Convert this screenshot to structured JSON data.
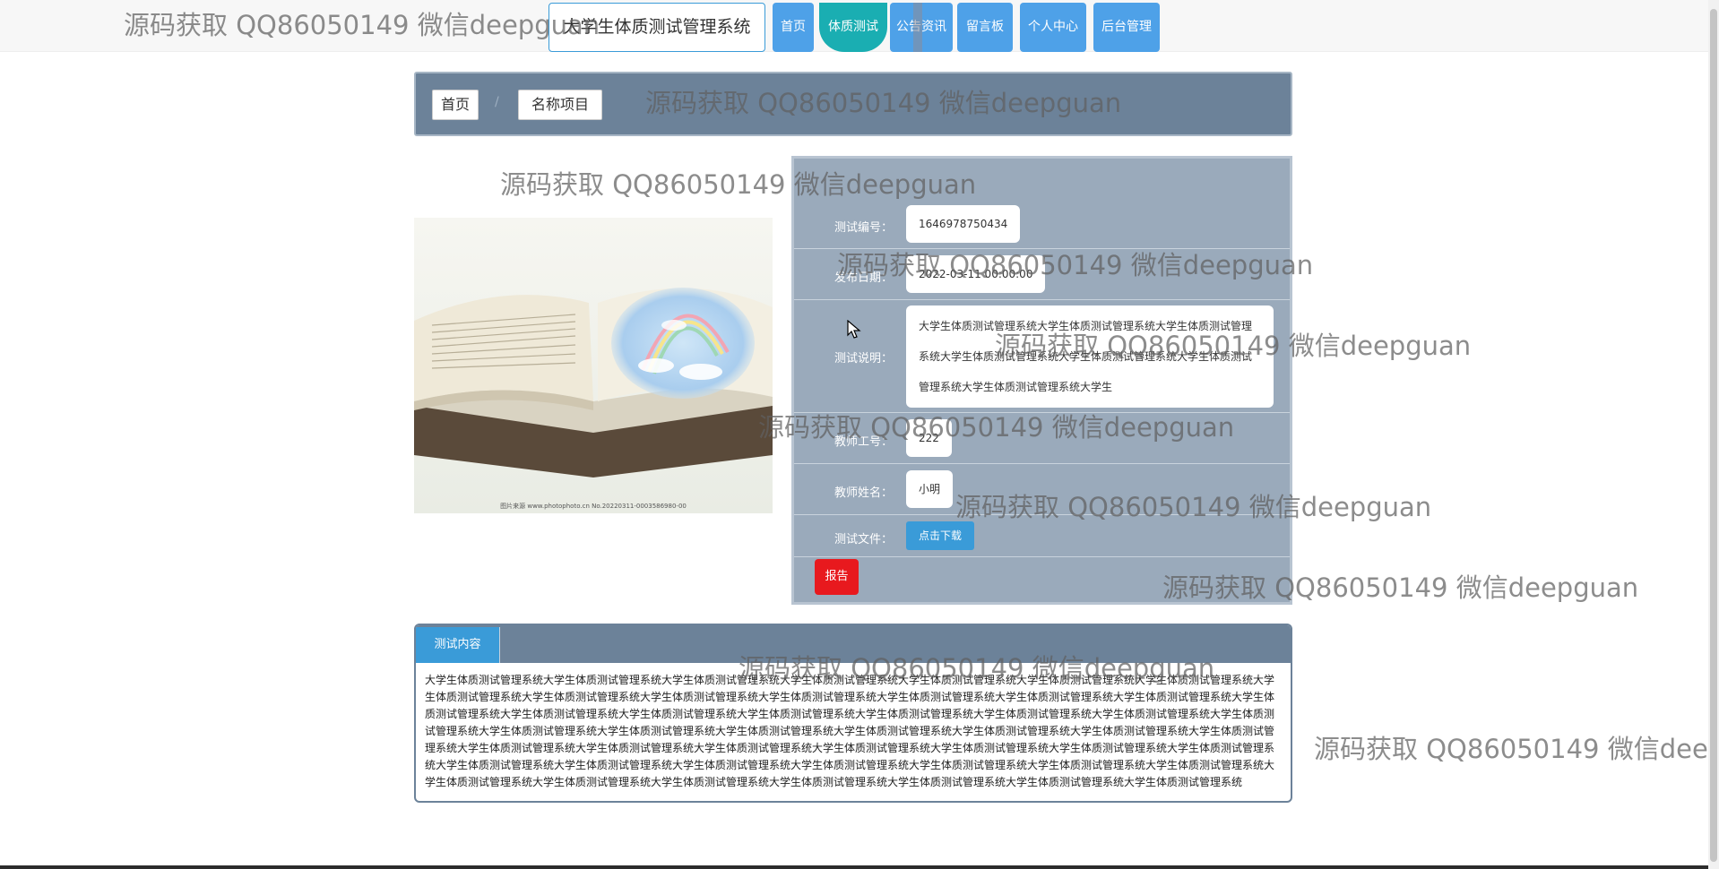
{
  "app": {
    "title": "大学生体质测试管理系统"
  },
  "nav": {
    "items": [
      {
        "label": "首页"
      },
      {
        "label": "体质测试"
      },
      {
        "label": "公告资讯"
      },
      {
        "label": "留言板"
      },
      {
        "label": "个人中心"
      },
      {
        "label": "后台管理"
      }
    ],
    "active": "体质测试"
  },
  "breadcrumb": {
    "home": "首页",
    "current": "名称项目"
  },
  "detail": {
    "test_id_label": "测试编号：",
    "test_id": "1646978750434",
    "publish_date_label": "发布日期：",
    "publish_date": "2022-03-11 00:00:00",
    "description_label": "测试说明：",
    "description": "大学生体质测试管理系统大学生体质测试管理系统大学生体质测试管理系统大学生体质测试管理系统大学生体质测试管理系统大学生体质测试管理系统大学生体质测试管理系统大学生",
    "teacher_id_label": "教师工号：",
    "teacher_id": "222",
    "teacher_name_label": "教师姓名：",
    "teacher_name": "小明",
    "file_label": "测试文件：",
    "download_button": "点击下载",
    "report_button": "报告"
  },
  "tab": {
    "label": "测试内容",
    "content": "大学生体质测试管理系统大学生体质测试管理系统大学生体质测试管理系统大学生体质测试管理系统大学生体质测试管理系统大学生体质测试管理系统大学生体质测试管理系统大学生体质测试管理系统大学生体质测试管理系统大学生体质测试管理系统大学生体质测试管理系统大学生体质测试管理系统大学生体质测试管理系统大学生体质测试管理系统大学生体质测试管理系统大学生体质测试管理系统大学生体质测试管理系统大学生体质测试管理系统大学生体质测试管理系统大学生体质测试管理系统大学生体质测试管理系统大学生体质测试管理系统大学生体质测试管理系统大学生体质测试管理系统大学生体质测试管理系统大学生体质测试管理系统大学生体质测试管理系统大学生体质测试管理系统大学生体质测试管理系统大学生体质测试管理系统大学生体质测试管理系统大学生体质测试管理系统大学生体质测试管理系统大学生体质测试管理系统大学生体质测试管理系统大学生体质测试管理系统大学生体质测试管理系统大学生体质测试管理系统大学生体质测试管理系统大学生体质测试管理系统大学生体质测试管理系统大学生体质测试管理系统大学生体质测试管理系统大学生体质测试管理系统大学生体质测试管理系统大学生体质测试管理系统大学生体质测试管理系统大学生体质测试管理系统大学生体质测试管理系统大学生体质测试管理系统"
  },
  "watermark": {
    "text": "源码获取 QQ86050149 微信deepguan",
    "text_clipped": "源码获取 QQ86050149 微信deep"
  },
  "image": {
    "caption": "图片来源 www.photophoto.cn No.20220311-0003586980-00"
  },
  "colors": {
    "nav_blue": "#4ea1e8",
    "nav_active": "#1aaeb2",
    "panel_bg": "#9aaabb",
    "header_slate": "#6c8299",
    "report_red": "#e8191e",
    "download_blue": "#3a9bd8"
  }
}
